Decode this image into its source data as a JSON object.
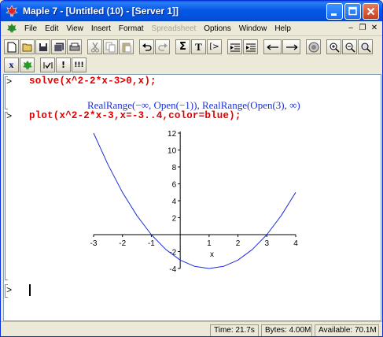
{
  "window": {
    "title": "Maple 7 - [Untitled (10) - [Server 1]]"
  },
  "menu": {
    "items": [
      {
        "label": "File",
        "disabled": false
      },
      {
        "label": "Edit",
        "disabled": false
      },
      {
        "label": "View",
        "disabled": false
      },
      {
        "label": "Insert",
        "disabled": false
      },
      {
        "label": "Format",
        "disabled": false
      },
      {
        "label": "Spreadsheet",
        "disabled": true
      },
      {
        "label": "Options",
        "disabled": false
      },
      {
        "label": "Window",
        "disabled": false
      },
      {
        "label": "Help",
        "disabled": false
      }
    ]
  },
  "toolbar": {
    "sigma_label": "Σ",
    "text_label": "T",
    "exec_label": "[>",
    "math_label": "x",
    "restart_label": "!",
    "exec_all_label": "!!!"
  },
  "worksheet": {
    "prompt_symbol": ">",
    "input1": "solve(x^2-2*x-3>0,x);",
    "output1": "RealRange(−∞, Open(−1)), RealRange(Open(3), ∞)",
    "input2": "plot(x^2-2*x-3,x=-3..4,color=blue);"
  },
  "status": {
    "time": "Time: 21.7s",
    "bytes": "Bytes: 4.00M",
    "available": "Available: 70.1M"
  },
  "colors": {
    "curve": "#1a2fd6",
    "input_text": "#e00000",
    "output_text": "#1a2fd6"
  },
  "chart_data": {
    "type": "line",
    "function": "x^2-2*x-3",
    "x_range": [
      -3,
      4
    ],
    "xlim": [
      -3,
      4
    ],
    "ylim": [
      -4,
      12
    ],
    "x_ticks": [
      -3,
      -2,
      -1,
      1,
      2,
      3,
      4
    ],
    "y_ticks": [
      -4,
      -2,
      2,
      4,
      6,
      8,
      10,
      12
    ],
    "x_tick_labels": [
      "-3",
      "-2",
      "-1",
      "1",
      "2",
      "3",
      "4"
    ],
    "y_tick_labels": [
      "-4",
      "-2",
      "2",
      "4",
      "6",
      "8",
      "10",
      "12"
    ],
    "xlabel": "x",
    "ylabel": "",
    "series": [
      {
        "color": "#1a2fd6",
        "x": [
          -3,
          -2.5,
          -2,
          -1.5,
          -1,
          -0.5,
          0,
          0.5,
          1,
          1.5,
          2,
          2.5,
          3,
          3.5,
          4
        ],
        "y": [
          12,
          8.25,
          5,
          2.25,
          0,
          -1.75,
          -3,
          -3.75,
          -4,
          -3.75,
          -3,
          -1.75,
          0,
          2.25,
          5
        ]
      }
    ]
  }
}
